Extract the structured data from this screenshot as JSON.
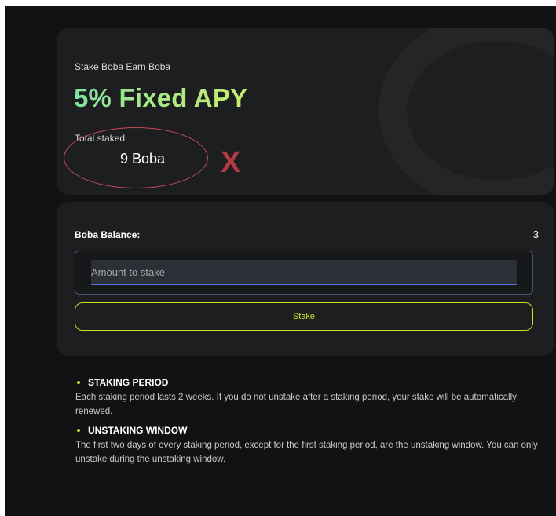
{
  "apy_card": {
    "subtitle": "Stake Boba Earn Boba",
    "title": "5% Fixed APY",
    "total_staked_label": "Total staked",
    "total_staked_value": "9 Boba",
    "annotation_mark": "X",
    "annotation_color": "#c24b57"
  },
  "stake_card": {
    "balance_label": "Boba Balance:",
    "balance_value": "3",
    "amount_placeholder": "Amount to stake",
    "amount_value": "",
    "stake_button_label": "Stake"
  },
  "info": [
    {
      "heading": "STAKING PERIOD",
      "text": "Each staking period lasts 2 weeks. If you do not unstake after a staking period, your stake will be automatically renewed."
    },
    {
      "heading": "UNSTAKING WINDOW",
      "text": "The first two days of every staking period, except for the first staking period, are the unstaking window. You can only unstake during the unstaking window."
    }
  ],
  "colors": {
    "background": "#111213",
    "card": "#1d1e20",
    "accent": "#c5e52b",
    "apy_gradient_start": "#7de2a1",
    "apy_gradient_end": "#c6ec6e",
    "input_underline": "#5a74e6"
  }
}
